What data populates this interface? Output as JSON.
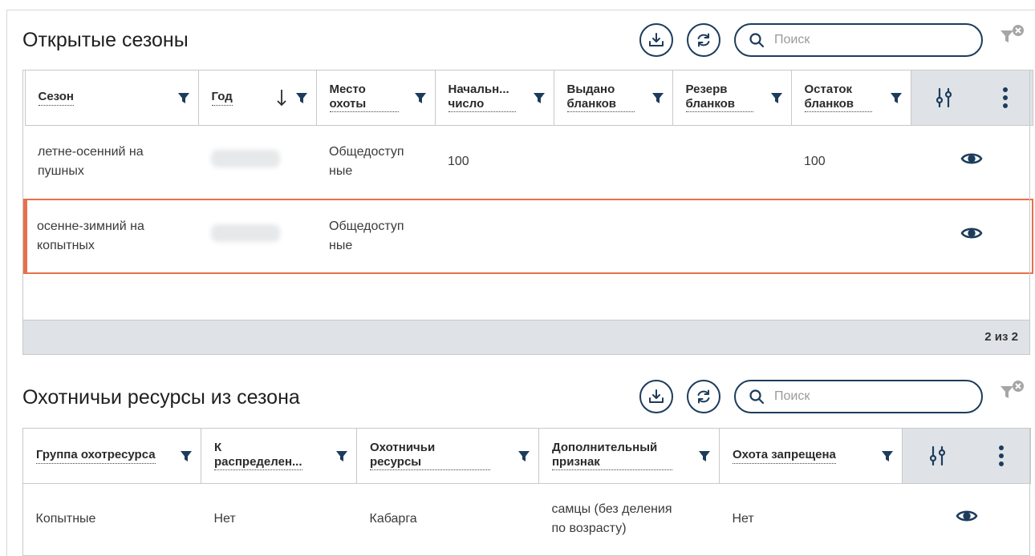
{
  "seasons": {
    "title": "Открытые сезоны",
    "search_placeholder": "Поиск",
    "columns": [
      {
        "label_line1": "Сезон",
        "label_line2": ""
      },
      {
        "label_line1": "Год",
        "label_line2": ""
      },
      {
        "label_line1": "Место",
        "label_line2": "охоты"
      },
      {
        "label_line1": "Начальн...",
        "label_line2": "число"
      },
      {
        "label_line1": "Выдано",
        "label_line2": "бланков"
      },
      {
        "label_line1": "Резерв",
        "label_line2": "бланков"
      },
      {
        "label_line1": "Остаток",
        "label_line2": "бланков"
      }
    ],
    "rows": [
      {
        "season_line1": "летне-осенний на",
        "season_line2": "пушных",
        "place_line1": "Общедоступ",
        "place_line2": "ные",
        "initial": "100",
        "issued": "",
        "reserve": "",
        "remaining": "100"
      },
      {
        "season_line1": "осенне-зимний на",
        "season_line2": "копытных",
        "place_line1": "Общедоступ",
        "place_line2": "ные",
        "initial": "",
        "issued": "",
        "reserve": "",
        "remaining": ""
      }
    ],
    "pager": "2 из 2",
    "selected_row_color": "#e8704a"
  },
  "resources": {
    "title": "Охотничьи ресурсы из сезона",
    "search_placeholder": "Поиск",
    "columns": [
      {
        "label_line1": "Группа охотресурса",
        "label_line2": ""
      },
      {
        "label_line1": "К",
        "label_line2": "распределен..."
      },
      {
        "label_line1": "Охотничьи",
        "label_line2": "ресурсы"
      },
      {
        "label_line1": "Дополнительный",
        "label_line2": "признак"
      },
      {
        "label_line1": "Охота запрещена",
        "label_line2": ""
      }
    ],
    "rows": [
      {
        "group": "Копытные",
        "distribution": "Нет",
        "resource": "Кабарга",
        "attr_line1": "самцы (без деления",
        "attr_line2": "по возрасту)",
        "banned": "Нет"
      }
    ]
  },
  "icons": {
    "download": "download-icon",
    "refresh": "refresh-icon",
    "search": "search-icon",
    "filter_clear": "filter-clear-icon",
    "filter": "filter-icon",
    "sort": "sort-desc-icon",
    "column_settings": "column-settings-icon",
    "more": "more-vertical-icon",
    "view": "eye-icon"
  },
  "colors": {
    "accent": "#1d3c5c",
    "header_gray": "#dfe3e8"
  }
}
